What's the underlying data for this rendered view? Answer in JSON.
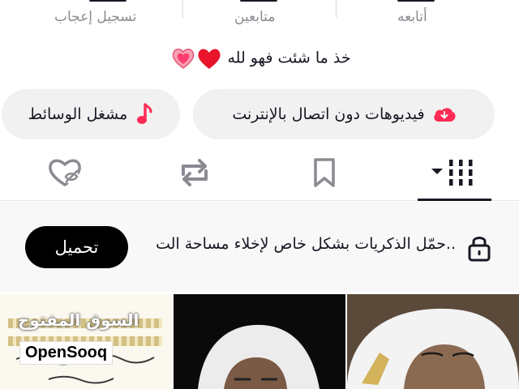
{
  "stats": {
    "following_label": "أتابعه",
    "followers_label": "متابعين",
    "likes_label": "تسجيل إعجاب"
  },
  "bio": {
    "text": "خذ ما شئت فهو لله"
  },
  "pills": {
    "offline_videos": "فيديوهات دون اتصال بالإنترنت",
    "media_player": "مشغل الوسائط"
  },
  "tabs": [
    "videos-grid",
    "saved",
    "reposts",
    "liked"
  ],
  "banner": {
    "text": "حمّل الذكريات بشكل خاص لإخلاء مساحة الت..",
    "button": "تحميل"
  },
  "thumbnails": {
    "watermark_ar": "السوق المفتوح",
    "watermark_en": "OpenSooq"
  },
  "colors": {
    "heart_red": "#e8142b",
    "pink_accent": "#fe2c55",
    "tab_active": "#161823"
  }
}
